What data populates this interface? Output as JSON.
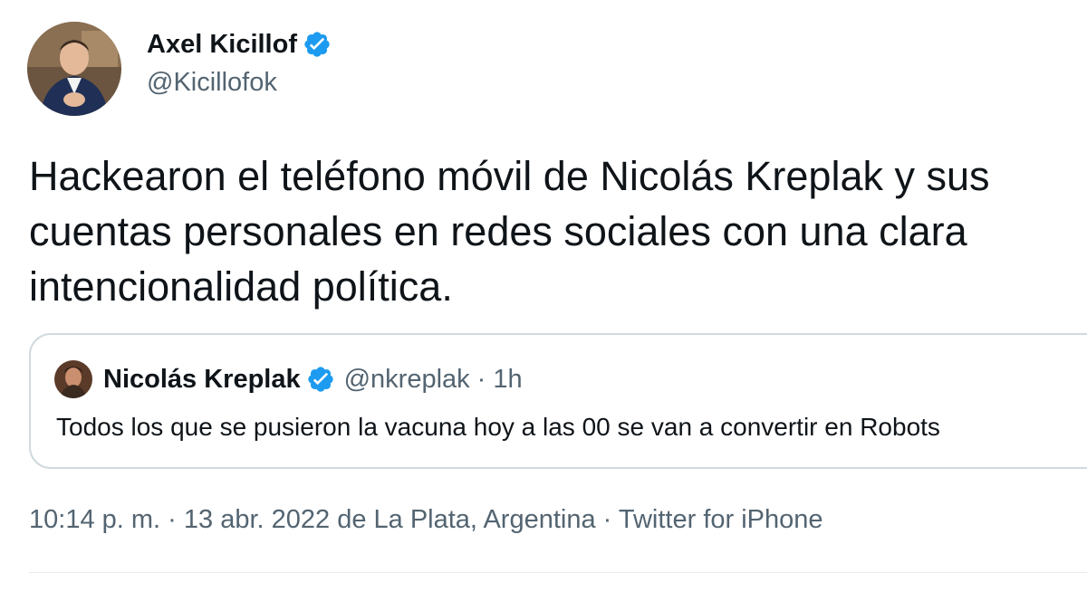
{
  "author": {
    "name": "Axel Kicillof",
    "handle": "@Kicillofok",
    "verified": true
  },
  "tweet": {
    "lines": [
      "Hackearon el teléfono móvil de Nicolás Kreplak y sus",
      "cuentas personales en redes sociales con una clara",
      "intencionalidad política."
    ]
  },
  "quoted_tweet": {
    "name": "Nicolás Kreplak",
    "handle": "@nkreplak",
    "separator": "·",
    "time": "1h",
    "text": "Todos los que se pusieron la vacuna hoy a las 00 se van a convertir en Robots",
    "verified": true
  },
  "meta": {
    "time": "10:14 p. m.",
    "sep1": "·",
    "date": "13 abr. 2022 de La Plata, Argentina",
    "sep2": "·",
    "source": "Twitter for iPhone"
  },
  "colors": {
    "verified_blue": "#1d9bf0",
    "secondary_text": "#536471",
    "border": "#cfd9de"
  },
  "icons": {
    "verified": "verified-badge-icon",
    "avatar": "avatar",
    "quoted_avatar": "quoted-avatar"
  }
}
